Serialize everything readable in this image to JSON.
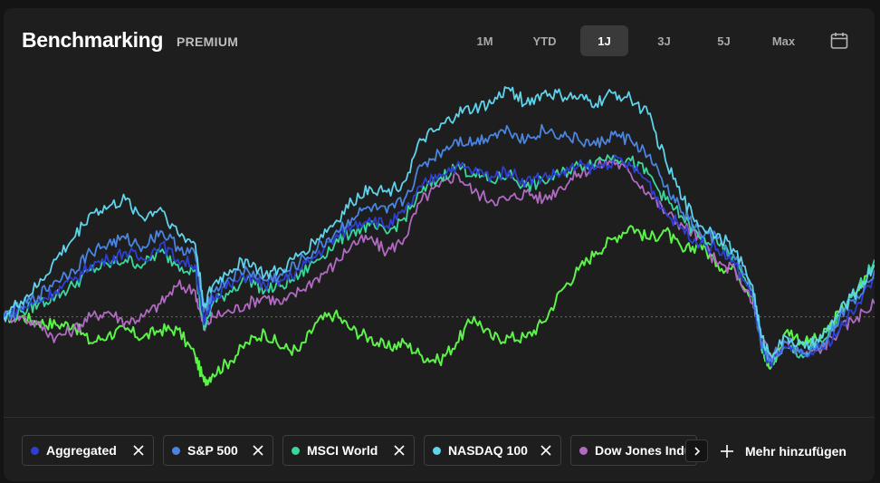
{
  "header": {
    "title": "Benchmarking",
    "badge": "PREMIUM",
    "ranges": [
      "1M",
      "YTD",
      "1J",
      "3J",
      "5J",
      "Max"
    ],
    "active_range": "1J",
    "calendar_icon": "calendar-icon"
  },
  "legend": {
    "items": [
      {
        "label": "Aggregated",
        "color": "#2f3fcf"
      },
      {
        "label": "S&P 500",
        "color": "#4a84e0"
      },
      {
        "label": "MSCI World",
        "color": "#3ad69a"
      },
      {
        "label": "NASDAQ 100",
        "color": "#5fd3ea"
      },
      {
        "label": "Dow Jones Indu",
        "color": "#b06ac2"
      }
    ],
    "scroll_icon": "chevron-right-icon",
    "add_label": "Mehr hinzufügen"
  },
  "chart_data": {
    "type": "line",
    "baseline": 0,
    "grid": false,
    "x_range": [
      0,
      1
    ],
    "y_range": [
      -35,
      95
    ],
    "series_colors": {
      "aggregated": "#2f3fcf",
      "sp500": "#4a84e0",
      "msci": "#3ad69a",
      "nasdaq": "#5fd3ea",
      "dowjones": "#b06ac2",
      "portfolio": "#5df24a"
    },
    "series": [
      {
        "key": "portfolio",
        "x": [
          0,
          0.02,
          0.04,
          0.06,
          0.08,
          0.1,
          0.12,
          0.14,
          0.16,
          0.18,
          0.2,
          0.22,
          0.23,
          0.24,
          0.26,
          0.28,
          0.3,
          0.32,
          0.34,
          0.36,
          0.38,
          0.4,
          0.42,
          0.44,
          0.46,
          0.48,
          0.5,
          0.52,
          0.54,
          0.56,
          0.58,
          0.6,
          0.62,
          0.64,
          0.66,
          0.68,
          0.7,
          0.72,
          0.74,
          0.76,
          0.78,
          0.8,
          0.82,
          0.84,
          0.86,
          0.87,
          0.88,
          0.9,
          0.92,
          0.94,
          0.96,
          0.98,
          1.0
        ],
        "y": [
          0,
          0,
          -2,
          -3,
          -3,
          -10,
          -7,
          -5,
          -8,
          -5,
          -5,
          -15,
          -25,
          -22,
          -17,
          -10,
          -6,
          -12,
          -13,
          -2,
          1,
          -5,
          -8,
          -12,
          -10,
          -15,
          -17,
          -10,
          0,
          -8,
          -8,
          -8,
          -2,
          10,
          18,
          25,
          30,
          35,
          30,
          33,
          25,
          28,
          20,
          18,
          8,
          -12,
          -20,
          -5,
          -10,
          -8,
          2,
          10,
          20
        ]
      },
      {
        "key": "dowjones",
        "x": [
          0,
          0.02,
          0.04,
          0.06,
          0.08,
          0.1,
          0.12,
          0.14,
          0.16,
          0.18,
          0.2,
          0.22,
          0.23,
          0.24,
          0.26,
          0.28,
          0.3,
          0.32,
          0.34,
          0.36,
          0.38,
          0.4,
          0.42,
          0.44,
          0.46,
          0.48,
          0.5,
          0.52,
          0.54,
          0.56,
          0.58,
          0.6,
          0.62,
          0.64,
          0.66,
          0.68,
          0.7,
          0.72,
          0.74,
          0.76,
          0.78,
          0.8,
          0.82,
          0.84,
          0.86,
          0.87,
          0.88,
          0.9,
          0.92,
          0.94,
          0.96,
          0.98,
          1.0
        ],
        "y": [
          0,
          0,
          -3,
          -8,
          -5,
          0,
          2,
          -2,
          0,
          5,
          12,
          10,
          -5,
          0,
          2,
          5,
          8,
          5,
          10,
          15,
          20,
          28,
          30,
          25,
          30,
          45,
          50,
          55,
          48,
          45,
          45,
          48,
          45,
          50,
          55,
          58,
          60,
          55,
          48,
          40,
          35,
          30,
          20,
          18,
          5,
          -8,
          -15,
          -10,
          -15,
          -12,
          -5,
          0,
          5
        ]
      },
      {
        "key": "msci",
        "x": [
          0,
          0.02,
          0.04,
          0.06,
          0.08,
          0.1,
          0.12,
          0.14,
          0.16,
          0.18,
          0.2,
          0.22,
          0.23,
          0.24,
          0.26,
          0.28,
          0.3,
          0.32,
          0.34,
          0.36,
          0.38,
          0.4,
          0.42,
          0.44,
          0.46,
          0.48,
          0.5,
          0.52,
          0.54,
          0.56,
          0.58,
          0.6,
          0.62,
          0.64,
          0.66,
          0.68,
          0.7,
          0.72,
          0.74,
          0.76,
          0.78,
          0.8,
          0.82,
          0.84,
          0.86,
          0.87,
          0.88,
          0.9,
          0.92,
          0.94,
          0.96,
          0.98,
          1.0
        ],
        "y": [
          0,
          2,
          5,
          8,
          12,
          18,
          20,
          22,
          20,
          25,
          20,
          18,
          -5,
          5,
          10,
          15,
          10,
          12,
          16,
          22,
          28,
          33,
          35,
          32,
          38,
          48,
          53,
          58,
          55,
          52,
          55,
          50,
          52,
          55,
          58,
          60,
          62,
          60,
          55,
          45,
          38,
          30,
          28,
          22,
          10,
          -12,
          -18,
          -12,
          -15,
          -10,
          0,
          10,
          22
        ]
      },
      {
        "key": "aggregated",
        "x": [
          0,
          0.02,
          0.04,
          0.06,
          0.08,
          0.1,
          0.12,
          0.14,
          0.16,
          0.18,
          0.2,
          0.22,
          0.23,
          0.24,
          0.26,
          0.28,
          0.3,
          0.32,
          0.34,
          0.36,
          0.38,
          0.4,
          0.42,
          0.44,
          0.46,
          0.48,
          0.5,
          0.52,
          0.54,
          0.56,
          0.58,
          0.6,
          0.62,
          0.64,
          0.66,
          0.68,
          0.7,
          0.72,
          0.74,
          0.76,
          0.78,
          0.8,
          0.82,
          0.84,
          0.86,
          0.87,
          0.88,
          0.9,
          0.92,
          0.94,
          0.96,
          0.98,
          1.0
        ],
        "y": [
          0,
          3,
          6,
          10,
          14,
          20,
          22,
          25,
          22,
          28,
          22,
          20,
          -3,
          8,
          12,
          16,
          12,
          14,
          18,
          24,
          30,
          35,
          38,
          35,
          40,
          50,
          55,
          58,
          56,
          54,
          56,
          52,
          54,
          55,
          58,
          57,
          60,
          58,
          52,
          40,
          34,
          28,
          26,
          20,
          8,
          -12,
          -18,
          -12,
          -15,
          -12,
          -5,
          5,
          15
        ]
      },
      {
        "key": "sp500",
        "x": [
          0,
          0.02,
          0.04,
          0.06,
          0.08,
          0.1,
          0.12,
          0.14,
          0.16,
          0.18,
          0.2,
          0.22,
          0.23,
          0.24,
          0.26,
          0.28,
          0.3,
          0.32,
          0.34,
          0.36,
          0.38,
          0.4,
          0.42,
          0.44,
          0.46,
          0.48,
          0.5,
          0.52,
          0.54,
          0.56,
          0.58,
          0.6,
          0.62,
          0.64,
          0.66,
          0.68,
          0.7,
          0.72,
          0.74,
          0.76,
          0.78,
          0.8,
          0.82,
          0.84,
          0.86,
          0.87,
          0.88,
          0.9,
          0.92,
          0.94,
          0.96,
          0.98,
          1.0
        ],
        "y": [
          0,
          4,
          8,
          14,
          18,
          25,
          28,
          30,
          27,
          33,
          27,
          24,
          2,
          10,
          15,
          18,
          14,
          16,
          21,
          26,
          32,
          38,
          42,
          40,
          45,
          58,
          63,
          68,
          67,
          70,
          72,
          68,
          72,
          70,
          68,
          66,
          70,
          68,
          62,
          50,
          40,
          32,
          30,
          22,
          10,
          -10,
          -16,
          -10,
          -14,
          -10,
          0,
          8,
          18
        ]
      },
      {
        "key": "nasdaq",
        "x": [
          0,
          0.02,
          0.04,
          0.06,
          0.08,
          0.1,
          0.12,
          0.14,
          0.16,
          0.18,
          0.2,
          0.22,
          0.23,
          0.24,
          0.26,
          0.28,
          0.3,
          0.32,
          0.34,
          0.36,
          0.38,
          0.4,
          0.42,
          0.44,
          0.46,
          0.48,
          0.5,
          0.52,
          0.54,
          0.56,
          0.58,
          0.6,
          0.62,
          0.64,
          0.66,
          0.68,
          0.7,
          0.72,
          0.74,
          0.76,
          0.78,
          0.8,
          0.82,
          0.84,
          0.86,
          0.87,
          0.88,
          0.9,
          0.92,
          0.94,
          0.96,
          0.98,
          1.0
        ],
        "y": [
          0,
          6,
          12,
          22,
          30,
          40,
          42,
          45,
          38,
          42,
          32,
          28,
          4,
          12,
          18,
          22,
          16,
          18,
          24,
          30,
          36,
          44,
          50,
          48,
          52,
          68,
          72,
          78,
          80,
          82,
          88,
          82,
          86,
          85,
          84,
          82,
          86,
          84,
          78,
          60,
          45,
          35,
          32,
          25,
          12,
          -8,
          -14,
          -8,
          -12,
          -8,
          2,
          10,
          20
        ]
      }
    ]
  }
}
